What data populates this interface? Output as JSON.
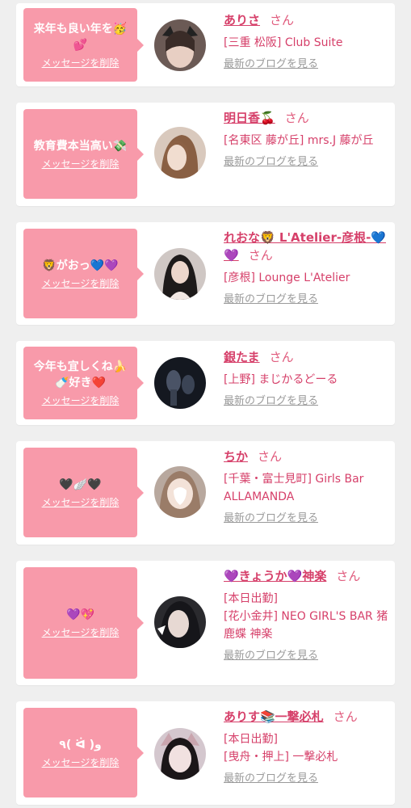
{
  "delete_label": "メッセージを削除",
  "blog_label": "最新のブログを見る",
  "san_label": "さん",
  "colors": {
    "bubble": "#f89aaa",
    "name": "#d6406a",
    "link_gray": "#9a9a9a",
    "background": "#efefef"
  },
  "entries": [
    {
      "message": "来年も良い年を🥳💕",
      "name": "ありさ",
      "shop": "[三重 松阪] Club Suite",
      "extra": ""
    },
    {
      "message": "教育費本当高い💸",
      "name": "明日香🍒",
      "shop": "[名東区 藤が丘] mrs.J 藤が丘",
      "extra": ""
    },
    {
      "message": "🦁がおっ💙💜",
      "name": "れおな🦁 L'Atelier-彦根-💙💜",
      "shop": "[彦根] Lounge L'Atelier",
      "extra": ""
    },
    {
      "message": "今年も宜しくね🍌🍼好き❤️",
      "name": "銀たま",
      "shop": "[上野] まじかるどーる",
      "extra": ""
    },
    {
      "message": "🖤🪽🖤",
      "name": "ちか",
      "shop": "[千葉・富士見町] Girls Bar ALLAMANDA",
      "extra": ""
    },
    {
      "message": "💜💖",
      "name": "💜きょうか💜神楽",
      "shop": "[花小金井] NEO GIRL'S BAR 猪鹿蝶 神楽",
      "extra": "[本日出勤]"
    },
    {
      "message": "٩( ᐛ )و",
      "name": "ありす📚一撃必札",
      "shop": "[曳舟・押上] 一撃必札",
      "extra": "[本日出勤]"
    }
  ]
}
